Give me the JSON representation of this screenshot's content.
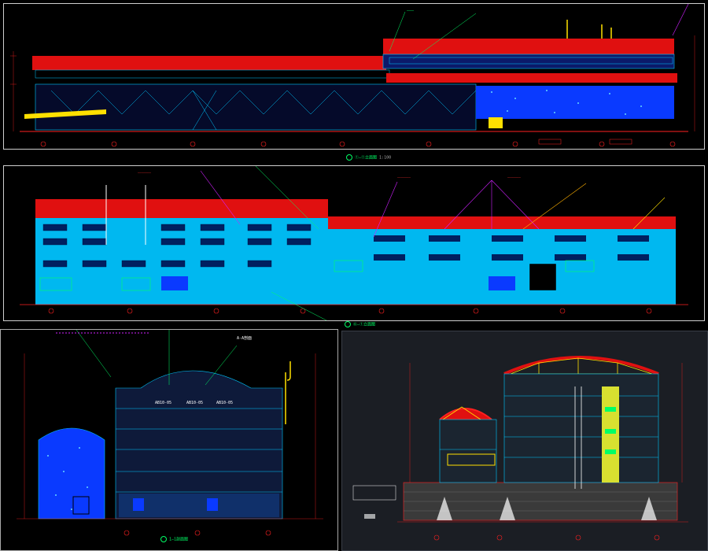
{
  "colors": {
    "background": "#000000",
    "roof": "#e01010",
    "facade_cyan": "#00c8ff",
    "facade_blue": "#0a3aff",
    "grid_red": "#ff2020",
    "annotation_green": "#00ff66",
    "annotation_magenta": "#d020ff",
    "yellow": "#ffe000",
    "dark_panel": "#1b1e24"
  },
  "panels": [
    {
      "id": "elevation-south",
      "icon": "cad-elevation"
    },
    {
      "id": "elevation-north",
      "icon": "cad-elevation"
    },
    {
      "id": "section-left",
      "icon": "cad-section"
    },
    {
      "id": "section-right",
      "icon": "cad-section"
    }
  ],
  "labels": {
    "elev1_title": "①—①立面图",
    "elev1_scale": "1:100",
    "elev2_title": "⑥—①立面图",
    "sec1_title": "1—1剖面图",
    "sec1_tag": "A-A剖面",
    "section_room_tag": "AB10-05"
  }
}
